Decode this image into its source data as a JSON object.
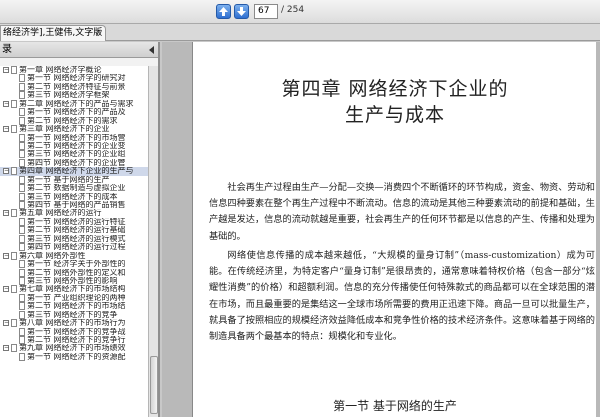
{
  "toolbar": {
    "current_page": "67",
    "total_pages": "/ 254"
  },
  "tab": {
    "title": "络经济学],王健伟,文字版",
    "close": "×"
  },
  "sidebar": {
    "header": "录",
    "items": [
      {
        "label": "第一章   网络经济学概论"
      },
      {
        "label": "第一节   网络经济学的研究对"
      },
      {
        "label": "第二节   网络经济特征与前景"
      },
      {
        "label": "第三节   网络经济学框架"
      },
      {
        "label": "第二章   网络经济下的产品与需求"
      },
      {
        "label": "第一节   网络经济下的产品及"
      },
      {
        "label": "第二节   网络经济下的需求"
      },
      {
        "label": "第三章   网络经济下的企业"
      },
      {
        "label": "第一节   网络经济下的市场营"
      },
      {
        "label": "第二节   网络经济下的企业变"
      },
      {
        "label": "第三节   网络经济下的企业组"
      },
      {
        "label": "第四节   网络经济下的企业管"
      },
      {
        "label": "第四章   网络经济下企业的生产与"
      },
      {
        "label": "第一节   基于网络的生产"
      },
      {
        "label": "第二节   数据制造与虚拟企业"
      },
      {
        "label": "第三节   网络经济下的成本"
      },
      {
        "label": "第四节   基于网络的产品销售"
      },
      {
        "label": "第五章   网络经济的运行"
      },
      {
        "label": "第一节   网络经济的运行特征"
      },
      {
        "label": "第二节   网络经济的运行基础"
      },
      {
        "label": "第三节   网络经济的运行模式"
      },
      {
        "label": "第四节   网络经济的运行过程"
      },
      {
        "label": "第六章   网络外部性"
      },
      {
        "label": "第一节   经济学关于外部性的"
      },
      {
        "label": "第二节   网络外部性的定义和"
      },
      {
        "label": "第三节   网络外部性的影响"
      },
      {
        "label": "第七章   网络经济下的市场结构"
      },
      {
        "label": "第一节   产业组织理论的两种"
      },
      {
        "label": "第二节   网络经济下的市场结"
      },
      {
        "label": "第三节   网络经济下的竞争"
      },
      {
        "label": "第八章   网络经济下的市场行为"
      },
      {
        "label": "第一节   网络经济下的竞争战"
      },
      {
        "label": "第二节   网络经济下的竞争行"
      },
      {
        "label": "第九章   网络经济下的市场绩效"
      },
      {
        "label": "第一节   网络经济下的资源配"
      }
    ]
  },
  "page": {
    "chapter_line1": "第四章   网络经济下企业的",
    "chapter_line2": "生产与成本",
    "para1": "社会再生产过程由生产—分配—交换—消费四个不断循环的环节构成，资金、物资、劳动和信息四种要素在整个再生产过程中不断流动。信息的流动是其他三种要素流动的前提和基础，生产越是发达，信息的流动就越是重要，社会再生产的任何环节都是以信息的产生、传播和处理为基础的。",
    "para2": "网络使信息传播的成本越来越低，“大规模的量身订制”（mass-customization）成为可能。在传统经济里，为特定客户“量身订制”是很昂贵的，通常意味着特权价格（包含一部分“炫耀性消费”的价格）和超额利润。信息的充分传播使任何特殊款式的商品都可以在全球范围的潜在市场，而且最重要的是集结这一全球市场所需要的费用正迅速下降。商品一旦可以批量生产，就具备了按照相应的规模经济效益降低成本和竞争性价格的技术经济条件。这意味着基于网络的制造具备两个最基本的特点：规模化和专业化。",
    "section": "第一节   基于网络的生产"
  }
}
